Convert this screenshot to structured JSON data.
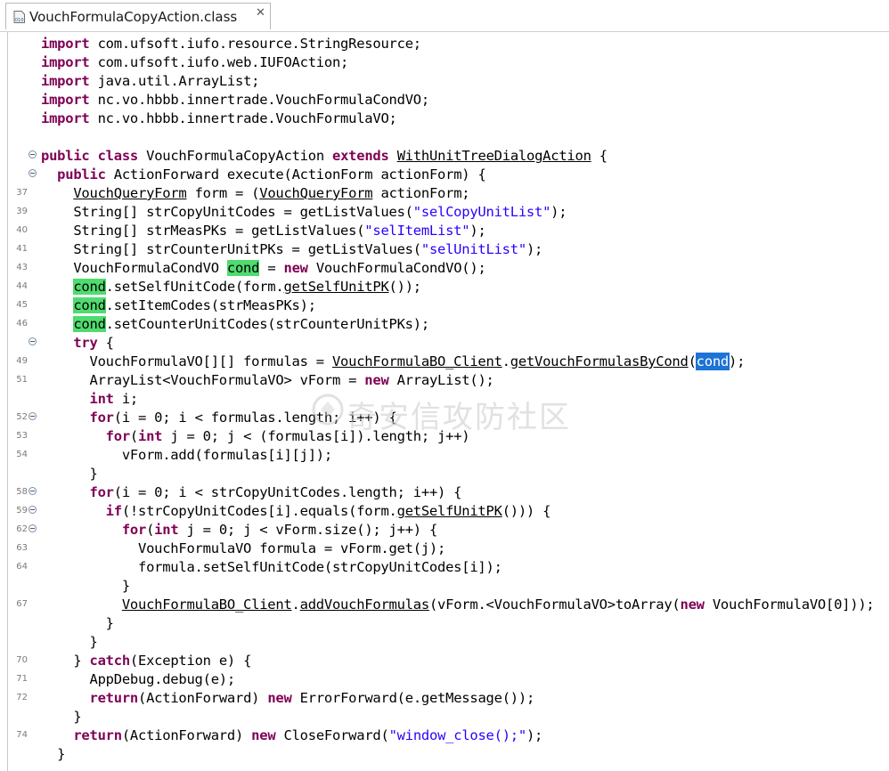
{
  "tab": {
    "title": "VouchFormulaCopyAction.class",
    "icon": "class-file-icon",
    "close_glyph": "✕"
  },
  "watermark": "奇安信攻防社区",
  "lines": [
    {
      "n": "",
      "fold": false,
      "t": [
        [
          "k",
          "import"
        ],
        [
          "",
          "com.ufsoft.iufo.resource.StringResource;"
        ]
      ]
    },
    {
      "n": "",
      "fold": false,
      "t": [
        [
          "k",
          "import"
        ],
        [
          "",
          "com.ufsoft.iufo.web.IUFOAction;"
        ]
      ]
    },
    {
      "n": "",
      "fold": false,
      "t": [
        [
          "k",
          "import"
        ],
        [
          "",
          "java.util.ArrayList;"
        ]
      ]
    },
    {
      "n": "",
      "fold": false,
      "t": [
        [
          "k",
          "import"
        ],
        [
          "",
          "nc.vo.hbbb.innertrade.VouchFormulaCondVO;"
        ]
      ]
    },
    {
      "n": "",
      "fold": false,
      "t": [
        [
          "k",
          "import"
        ],
        [
          "",
          "nc.vo.hbbb.innertrade.VouchFormulaVO;"
        ]
      ]
    },
    {
      "n": "",
      "fold": false,
      "t": []
    },
    {
      "n": "",
      "fold": true,
      "t": [
        [
          "k",
          "public"
        ],
        [
          "",
          ""
        ],
        [
          "k",
          "class"
        ],
        [
          "",
          "VouchFormulaCopyAction"
        ],
        [
          "k",
          "extends"
        ],
        [
          "u",
          "WithUnitTreeDialogAction"
        ],
        [
          "",
          "{"
        ]
      ]
    },
    {
      "n": "",
      "fold": true,
      "t": [
        [
          "",
          "  "
        ],
        [
          "k",
          "public"
        ],
        [
          "",
          "ActionForward execute(ActionForm actionForm) {"
        ]
      ]
    },
    {
      "n": "37",
      "fold": false,
      "t": [
        [
          "",
          "    "
        ],
        [
          "u",
          "VouchQueryForm"
        ],
        [
          "",
          "form = ("
        ],
        [
          "u",
          "VouchQueryForm"
        ],
        [
          "",
          "actionForm;"
        ]
      ]
    },
    {
      "n": "39",
      "fold": false,
      "t": [
        [
          "",
          "    String[] strCopyUnitCodes = getListValues("
        ],
        [
          "s",
          "\"selCopyUnitList\""
        ],
        [
          "",
          ");"
        ]
      ]
    },
    {
      "n": "40",
      "fold": false,
      "t": [
        [
          "",
          "    String[] strMeasPKs = getListValues("
        ],
        [
          "s",
          "\"selItemList\""
        ],
        [
          "",
          ");"
        ]
      ]
    },
    {
      "n": "41",
      "fold": false,
      "t": [
        [
          "",
          "    String[] strCounterUnitPKs = getListValues("
        ],
        [
          "s",
          "\"selUnitList\""
        ],
        [
          "",
          ");"
        ]
      ]
    },
    {
      "n": "43",
      "fold": false,
      "t": [
        [
          "",
          "    VouchFormulaCondVO "
        ],
        [
          "hl",
          "cond"
        ],
        [
          "",
          "= "
        ],
        [
          "k",
          "new"
        ],
        [
          "",
          "VouchFormulaCondVO();"
        ]
      ]
    },
    {
      "n": "44",
      "fold": false,
      "t": [
        [
          "",
          "    "
        ],
        [
          "hl",
          "cond"
        ],
        [
          "",
          ".setSelfUnitCode(form."
        ],
        [
          "u",
          "getSelfUnitPK"
        ],
        [
          "",
          "());"
        ]
      ]
    },
    {
      "n": "45",
      "fold": false,
      "t": [
        [
          "",
          "    "
        ],
        [
          "hl",
          "cond"
        ],
        [
          "",
          ".setItemCodes(strMeasPKs);"
        ]
      ]
    },
    {
      "n": "46",
      "fold": false,
      "t": [
        [
          "",
          "    "
        ],
        [
          "hl",
          "cond"
        ],
        [
          "",
          ".setCounterUnitCodes(strCounterUnitPKs);"
        ]
      ]
    },
    {
      "n": "",
      "fold": true,
      "t": [
        [
          "",
          "    "
        ],
        [
          "k",
          "try"
        ],
        [
          "",
          "{"
        ]
      ]
    },
    {
      "n": "49",
      "fold": false,
      "t": [
        [
          "",
          "      VouchFormulaVO[][] formulas = "
        ],
        [
          "u",
          "VouchFormulaBO_Client"
        ],
        [
          "",
          "."
        ],
        [
          "u",
          "getVouchFormulasByCond"
        ],
        [
          "",
          "("
        ],
        [
          "sel",
          "cond"
        ],
        [
          "",
          ");"
        ]
      ]
    },
    {
      "n": "51",
      "fold": false,
      "t": [
        [
          "",
          "      ArrayList<VouchFormulaVO> vForm = "
        ],
        [
          "k",
          "new"
        ],
        [
          "",
          "ArrayList();"
        ]
      ]
    },
    {
      "n": "",
      "fold": false,
      "t": [
        [
          "",
          "      "
        ],
        [
          "k",
          "int"
        ],
        [
          "",
          "i;"
        ]
      ]
    },
    {
      "n": "52",
      "fold": true,
      "t": [
        [
          "",
          "      "
        ],
        [
          "k",
          "for"
        ],
        [
          "",
          "(i = 0; i < formulas.length; i++) {"
        ]
      ]
    },
    {
      "n": "53",
      "fold": false,
      "t": [
        [
          "",
          "        "
        ],
        [
          "k",
          "for"
        ],
        [
          "",
          "("
        ],
        [
          "k",
          "int"
        ],
        [
          "",
          "j = 0; j < (formulas[i]).length; j++)"
        ]
      ]
    },
    {
      "n": "54",
      "fold": false,
      "t": [
        [
          "",
          "          vForm.add(formulas[i][j]);"
        ]
      ]
    },
    {
      "n": "",
      "fold": false,
      "t": [
        [
          "",
          "      }"
        ]
      ]
    },
    {
      "n": "58",
      "fold": true,
      "t": [
        [
          "",
          "      "
        ],
        [
          "k",
          "for"
        ],
        [
          "",
          "(i = 0; i < strCopyUnitCodes.length; i++) {"
        ]
      ]
    },
    {
      "n": "59",
      "fold": true,
      "t": [
        [
          "",
          "        "
        ],
        [
          "k",
          "if"
        ],
        [
          "",
          "(!strCopyUnitCodes[i].equals(form."
        ],
        [
          "u",
          "getSelfUnitPK"
        ],
        [
          "",
          "())) {"
        ]
      ]
    },
    {
      "n": "62",
      "fold": true,
      "t": [
        [
          "",
          "          "
        ],
        [
          "k",
          "for"
        ],
        [
          "",
          "("
        ],
        [
          "k",
          "int"
        ],
        [
          "",
          "j = 0; j < vForm.size(); j++) {"
        ]
      ]
    },
    {
      "n": "63",
      "fold": false,
      "t": [
        [
          "",
          "            VouchFormulaVO formula = vForm.get(j);"
        ]
      ]
    },
    {
      "n": "64",
      "fold": false,
      "t": [
        [
          "",
          "            formula.setSelfUnitCode(strCopyUnitCodes[i]);"
        ]
      ]
    },
    {
      "n": "",
      "fold": false,
      "t": [
        [
          "",
          "          }"
        ]
      ]
    },
    {
      "n": "67",
      "fold": false,
      "t": [
        [
          "",
          "          "
        ],
        [
          "u",
          "VouchFormulaBO_Client"
        ],
        [
          "",
          "."
        ],
        [
          "u",
          "addVouchFormulas"
        ],
        [
          "",
          "(vForm.<VouchFormulaVO>toArray("
        ],
        [
          "k",
          "new"
        ],
        [
          "",
          "VouchFormulaVO[0]));"
        ]
      ]
    },
    {
      "n": "",
      "fold": false,
      "t": [
        [
          "",
          "        }"
        ]
      ]
    },
    {
      "n": "",
      "fold": false,
      "t": [
        [
          "",
          "      }"
        ]
      ]
    },
    {
      "n": "70",
      "fold": false,
      "t": [
        [
          "",
          "    } "
        ],
        [
          "k",
          "catch"
        ],
        [
          "",
          "(Exception e) {"
        ]
      ]
    },
    {
      "n": "71",
      "fold": false,
      "t": [
        [
          "",
          "      AppDebug.debug(e);"
        ]
      ]
    },
    {
      "n": "72",
      "fold": false,
      "t": [
        [
          "",
          "      "
        ],
        [
          "k",
          "return"
        ],
        [
          "",
          "(ActionForward)"
        ],
        [
          "k",
          "new"
        ],
        [
          "",
          "ErrorForward(e.getMessage());"
        ]
      ]
    },
    {
      "n": "",
      "fold": false,
      "t": [
        [
          "",
          "    }"
        ]
      ]
    },
    {
      "n": "74",
      "fold": false,
      "t": [
        [
          "",
          "    "
        ],
        [
          "k",
          "return"
        ],
        [
          "",
          "(ActionForward)"
        ],
        [
          "k",
          "new"
        ],
        [
          "",
          "CloseForward("
        ],
        [
          "s",
          "\"window_close();\""
        ],
        [
          "",
          ");"
        ]
      ]
    },
    {
      "n": "",
      "fold": false,
      "t": [
        [
          "",
          "  }"
        ]
      ]
    }
  ]
}
